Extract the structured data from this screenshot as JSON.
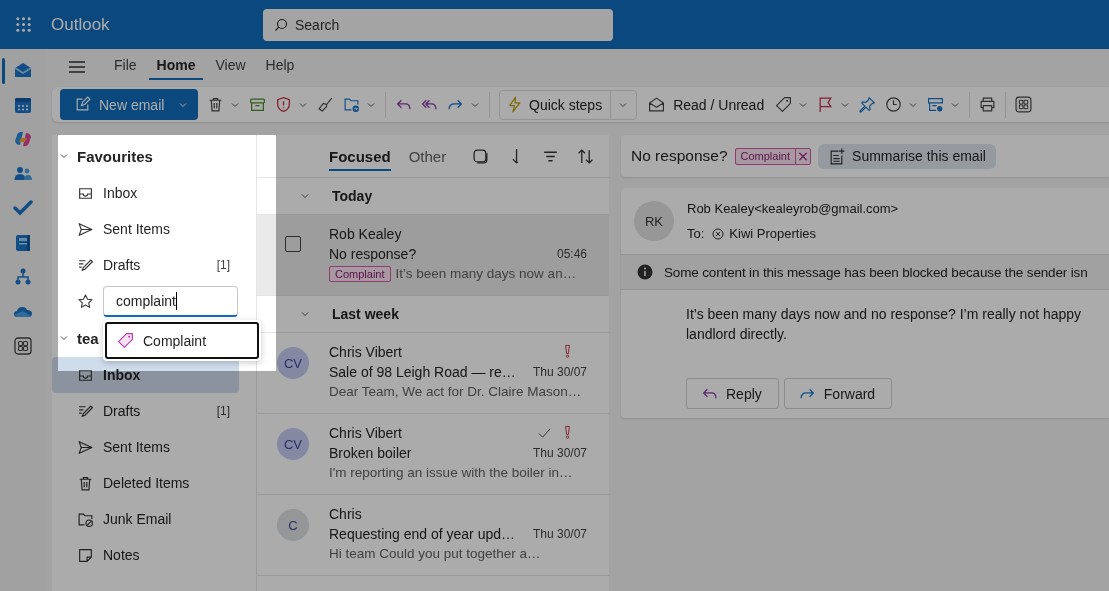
{
  "app": {
    "name": "Outlook"
  },
  "search": {
    "placeholder": "Search"
  },
  "menu_tabs": [
    {
      "label": "File",
      "selected": false
    },
    {
      "label": "Home",
      "selected": true
    },
    {
      "label": "View",
      "selected": false
    },
    {
      "label": "Help",
      "selected": false
    }
  ],
  "ribbon": {
    "new_email": "New email",
    "quick_steps": "Quick steps",
    "read_unread": "Read / Unread"
  },
  "favourites": {
    "title": "Favourites",
    "expanded": true,
    "items": [
      {
        "kind": "inbox",
        "label": "Inbox",
        "selected": false
      },
      {
        "kind": "sent",
        "label": "Sent Items",
        "selected": false
      },
      {
        "kind": "drafts",
        "label": "Drafts",
        "count": "[1]",
        "selected": false
      }
    ],
    "add_field": {
      "value": "complaint",
      "focused": true
    },
    "suggestions": [
      {
        "label": "Complaint",
        "selected": true
      }
    ]
  },
  "account": {
    "title": "tea",
    "expanded": true,
    "items": [
      {
        "kind": "inbox",
        "label": "Inbox",
        "selected": true
      },
      {
        "kind": "drafts",
        "label": "Drafts",
        "count": "[1]",
        "selected": false
      },
      {
        "kind": "sent",
        "label": "Sent Items",
        "selected": false
      },
      {
        "kind": "deleted",
        "label": "Deleted Items",
        "selected": false
      },
      {
        "kind": "junk",
        "label": "Junk Email",
        "selected": false
      },
      {
        "kind": "notes",
        "label": "Notes",
        "selected": false
      }
    ]
  },
  "message_list": {
    "tabs": [
      {
        "label": "Focused",
        "selected": true
      },
      {
        "label": "Other",
        "selected": false
      }
    ],
    "groups": [
      {
        "title": "Today",
        "expanded": true,
        "messages": [
          {
            "sender": "Rob Kealey",
            "subject": "No response?",
            "time": "05:46",
            "tag": "Complaint",
            "preview": "It’s been many days now an…",
            "checked": false,
            "selected": true,
            "important": false,
            "replied": false
          }
        ]
      },
      {
        "title": "Last week",
        "expanded": true,
        "messages": [
          {
            "sender": "Chris Vibert",
            "initials": "CV",
            "color": "#8488a3",
            "subject": "Sale of 98 Leigh Road — re…",
            "time": "Thu 30/07",
            "preview": "Dear Team, We act for Dr. Claire Mason…",
            "selected": false,
            "important": true,
            "replied": false
          },
          {
            "sender": "Chris Vibert",
            "initials": "CV",
            "color": "#8488a3",
            "subject": "Broken boiler",
            "time": "Thu 30/07",
            "preview": "I'm reporting an issue with the boiler in…",
            "selected": false,
            "important": true,
            "replied": true
          },
          {
            "sender": "Chris",
            "initials": "C",
            "color": "#949698",
            "subject": "Requesting end of year upd…",
            "time": "Thu 30/07",
            "preview": "Hi team Could you put together a…",
            "selected": false,
            "important": false,
            "replied": false
          }
        ]
      }
    ]
  },
  "reading": {
    "subject": "No response?",
    "tag": "Complaint",
    "summarise": "Summarise this email",
    "initials": "RK",
    "sender": "Rob Kealey<kealeyrob@gmail.com>",
    "to_label": "To:",
    "recipient": "Kiwi Properties",
    "notice": "Some content in this message has been blocked because the sender isn",
    "body": [
      "It’s been many days now and no response? I’m really not happy",
      "landlord directly."
    ],
    "actions": [
      {
        "kind": "reply",
        "label": "Reply"
      },
      {
        "kind": "forward",
        "label": "Forward"
      }
    ]
  }
}
